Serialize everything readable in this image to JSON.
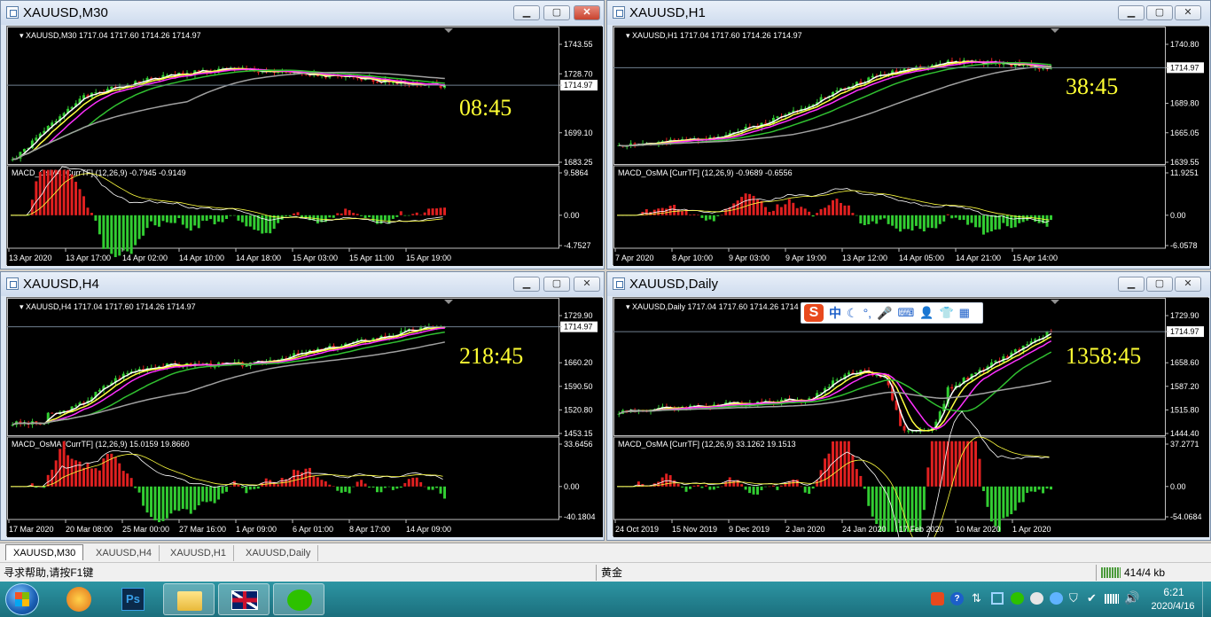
{
  "windows": [
    {
      "title": "XAUUSD,M30",
      "info": "XAUUSD,M30  1717.04 1717.60 1714.26 1714.97",
      "timer": "08:45",
      "price_ticks": [
        "1743.55",
        "1728.70",
        "1714.97",
        "1699.10",
        "1683.25"
      ],
      "macd_label": "MACD_OsMA [CurrTF] (12,26,9) -0.7945 -0.9149",
      "macd_ticks": [
        "9.5864",
        "0.00",
        "-4.7527"
      ],
      "time_ticks": [
        "13 Apr 2020",
        "13 Apr 17:00",
        "14 Apr 02:00",
        "14 Apr 10:00",
        "14 Apr 18:00",
        "15 Apr 03:00",
        "15 Apr 11:00",
        "15 Apr 19:00"
      ]
    },
    {
      "title": "XAUUSD,H1",
      "info": "XAUUSD,H1  1717.04 1717.60 1714.26 1714.97",
      "timer": "38:45",
      "price_ticks": [
        "1740.80",
        "1714.97",
        "1689.80",
        "1665.05",
        "1639.55"
      ],
      "macd_label": "MACD_OsMA [CurrTF] (12,26,9) -0.9689 -0.6556",
      "macd_ticks": [
        "11.9251",
        "0.00",
        "-6.0578"
      ],
      "time_ticks": [
        "7 Apr 2020",
        "8 Apr 10:00",
        "9 Apr 03:00",
        "9 Apr 19:00",
        "13 Apr 12:00",
        "14 Apr 05:00",
        "14 Apr 21:00",
        "15 Apr 14:00"
      ]
    },
    {
      "title": "XAUUSD,H4",
      "info": "XAUUSD,H4  1717.04 1717.60 1714.26 1714.97",
      "timer": "218:45",
      "price_ticks": [
        "1729.90",
        "1714.97",
        "1660.20",
        "1590.50",
        "1520.80",
        "1453.15"
      ],
      "macd_label": "MACD_OsMA [CurrTF] (12,26,9) 15.0159 19.8660",
      "macd_ticks": [
        "33.6456",
        "0.00",
        "-40.1804"
      ],
      "time_ticks": [
        "17 Mar 2020",
        "20 Mar 08:00",
        "25 Mar 00:00",
        "27 Mar 16:00",
        "1 Apr 09:00",
        "6 Apr 01:00",
        "8 Apr 17:00",
        "14 Apr 09:00"
      ]
    },
    {
      "title": "XAUUSD,Daily",
      "info": "XAUUSD,Daily  1717.04 1717.60 1714.26 1714",
      "timer": "1358:45",
      "price_ticks": [
        "1729.90",
        "1714.97",
        "1658.60",
        "1587.20",
        "1515.80",
        "1444.40"
      ],
      "macd_label": "MACD_OsMA [CurrTF] (12,26,9) 33.1262 19.1513",
      "macd_ticks": [
        "37.2771",
        "0.00",
        "-54.0684"
      ],
      "time_ticks": [
        "24 Oct 2019",
        "15 Nov 2019",
        "9 Dec 2019",
        "2 Jan 2020",
        "24 Jan 2020",
        "17 Feb 2020",
        "10 Mar 2020",
        "1 Apr 2020"
      ]
    }
  ],
  "ime": {
    "mode": "中"
  },
  "tabs": [
    "XAUUSD,M30",
    "XAUUSD,H4",
    "XAUUSD,H1",
    "XAUUSD,Daily"
  ],
  "status": {
    "help": "寻求帮助,请按F1键",
    "profile": "黄金",
    "traffic": "414/4 kb"
  },
  "taskbar": {
    "time": "6:21",
    "date": "2020/4/16"
  },
  "colors": {
    "bull": "#32cd32",
    "bear": "#e02020",
    "ma_fast": "#ffffff",
    "ma_yellow": "#ffff40",
    "ma_magenta": "#ff30ff",
    "ma_green": "#30c030",
    "ma_gray": "#a0a0a0",
    "timer": "#ffff33"
  }
}
